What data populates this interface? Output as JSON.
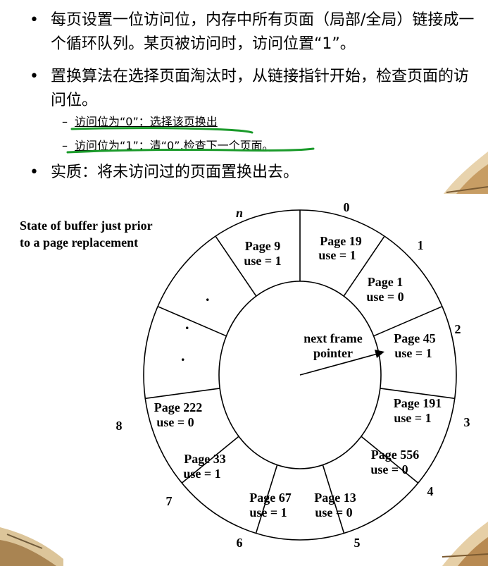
{
  "bullets": [
    {
      "marker": "•",
      "text": "每页设置一位访问位，内存中所有页面（局部/全局）链接成一个循环队列。某页被访问时，访问位置“1”。"
    },
    {
      "marker": "•",
      "text": "置换算法在选择页面淘汰时，从链接指针开始，检查页面的访问位。"
    }
  ],
  "sub_items": [
    {
      "marker": "–",
      "text": "访问位为“0”：选择该页换出"
    },
    {
      "marker": "–",
      "text": "访问位为“1”：清“0”,检查下一个页面。"
    }
  ],
  "essence": {
    "marker": "•",
    "text": "实质：将未访问过的页面置换出去。"
  },
  "buffer_label": "State of buffer just prior to a page replacement",
  "pointer_label_line1": "next frame",
  "pointer_label_line2": "pointer",
  "dots": ".",
  "position_labels": [
    "0",
    "1",
    "2",
    "3",
    "4",
    "5",
    "6",
    "7",
    "8",
    "n"
  ],
  "frames": [
    {
      "page": "Page 19",
      "use": "use = 1"
    },
    {
      "page": "Page 1",
      "use": "use = 0"
    },
    {
      "page": "Page 45",
      "use": "use = 1"
    },
    {
      "page": "Page 191",
      "use": "use = 1"
    },
    {
      "page": "Page 556",
      "use": "use = 0"
    },
    {
      "page": "Page 13",
      "use": "use = 0"
    },
    {
      "page": "Page 67",
      "use": "use = 1"
    },
    {
      "page": "Page 33",
      "use": "use = 1"
    },
    {
      "page": "Page 222",
      "use": "use = 0"
    },
    {
      "page": "Page 9",
      "use": "use = 1"
    }
  ],
  "colors": {
    "highlight": "#1a9a2a",
    "ink": "#000000"
  }
}
